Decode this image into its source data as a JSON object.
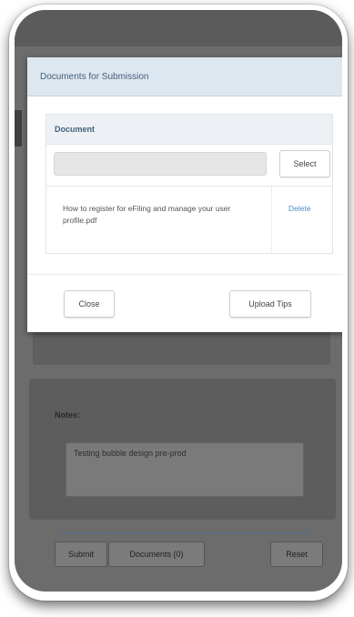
{
  "modal": {
    "title": "Documents for Submission",
    "table": {
      "header": "Document",
      "select_label": "Select",
      "files": [
        {
          "name": "How to register for eFiling and manage your user profile.pdf",
          "action": "Delete"
        }
      ]
    },
    "close_label": "Close",
    "upload_tips_label": "Upload Tips"
  },
  "background": {
    "notes_label": "Notes:",
    "notes_value": "Testing bubble design pre-prod",
    "submit_label": "Submit",
    "documents_label": "Documents (0)",
    "reset_label": "Reset"
  },
  "colors": {
    "header_bg": "#dde7ef",
    "header_text": "#45607a",
    "link": "#4c8ac4",
    "overlay": "#6c6c6c"
  }
}
